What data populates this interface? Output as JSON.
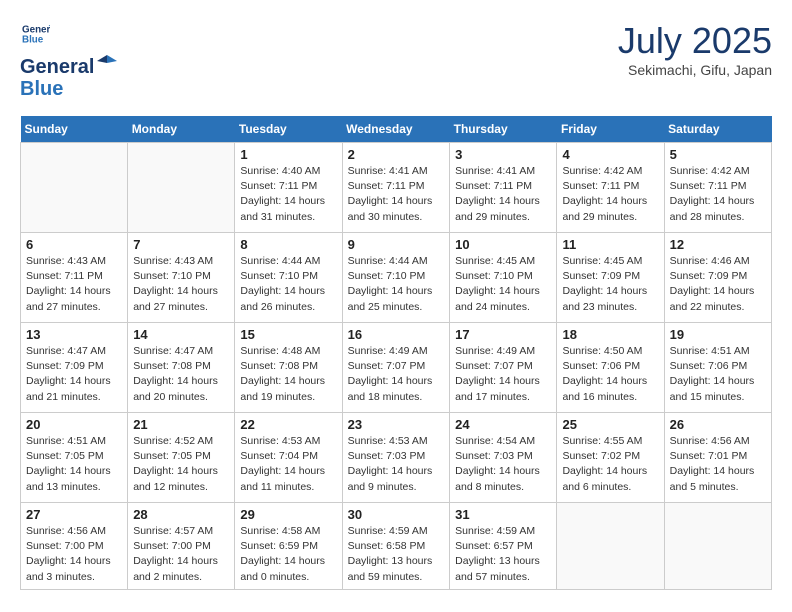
{
  "header": {
    "logo_line1": "General",
    "logo_line2": "Blue",
    "month": "July 2025",
    "location": "Sekimachi, Gifu, Japan"
  },
  "weekdays": [
    "Sunday",
    "Monday",
    "Tuesday",
    "Wednesday",
    "Thursday",
    "Friday",
    "Saturday"
  ],
  "weeks": [
    [
      {
        "day": "",
        "info": ""
      },
      {
        "day": "",
        "info": ""
      },
      {
        "day": "1",
        "info": "Sunrise: 4:40 AM\nSunset: 7:11 PM\nDaylight: 14 hours\nand 31 minutes."
      },
      {
        "day": "2",
        "info": "Sunrise: 4:41 AM\nSunset: 7:11 PM\nDaylight: 14 hours\nand 30 minutes."
      },
      {
        "day": "3",
        "info": "Sunrise: 4:41 AM\nSunset: 7:11 PM\nDaylight: 14 hours\nand 29 minutes."
      },
      {
        "day": "4",
        "info": "Sunrise: 4:42 AM\nSunset: 7:11 PM\nDaylight: 14 hours\nand 29 minutes."
      },
      {
        "day": "5",
        "info": "Sunrise: 4:42 AM\nSunset: 7:11 PM\nDaylight: 14 hours\nand 28 minutes."
      }
    ],
    [
      {
        "day": "6",
        "info": "Sunrise: 4:43 AM\nSunset: 7:11 PM\nDaylight: 14 hours\nand 27 minutes."
      },
      {
        "day": "7",
        "info": "Sunrise: 4:43 AM\nSunset: 7:10 PM\nDaylight: 14 hours\nand 27 minutes."
      },
      {
        "day": "8",
        "info": "Sunrise: 4:44 AM\nSunset: 7:10 PM\nDaylight: 14 hours\nand 26 minutes."
      },
      {
        "day": "9",
        "info": "Sunrise: 4:44 AM\nSunset: 7:10 PM\nDaylight: 14 hours\nand 25 minutes."
      },
      {
        "day": "10",
        "info": "Sunrise: 4:45 AM\nSunset: 7:10 PM\nDaylight: 14 hours\nand 24 minutes."
      },
      {
        "day": "11",
        "info": "Sunrise: 4:45 AM\nSunset: 7:09 PM\nDaylight: 14 hours\nand 23 minutes."
      },
      {
        "day": "12",
        "info": "Sunrise: 4:46 AM\nSunset: 7:09 PM\nDaylight: 14 hours\nand 22 minutes."
      }
    ],
    [
      {
        "day": "13",
        "info": "Sunrise: 4:47 AM\nSunset: 7:09 PM\nDaylight: 14 hours\nand 21 minutes."
      },
      {
        "day": "14",
        "info": "Sunrise: 4:47 AM\nSunset: 7:08 PM\nDaylight: 14 hours\nand 20 minutes."
      },
      {
        "day": "15",
        "info": "Sunrise: 4:48 AM\nSunset: 7:08 PM\nDaylight: 14 hours\nand 19 minutes."
      },
      {
        "day": "16",
        "info": "Sunrise: 4:49 AM\nSunset: 7:07 PM\nDaylight: 14 hours\nand 18 minutes."
      },
      {
        "day": "17",
        "info": "Sunrise: 4:49 AM\nSunset: 7:07 PM\nDaylight: 14 hours\nand 17 minutes."
      },
      {
        "day": "18",
        "info": "Sunrise: 4:50 AM\nSunset: 7:06 PM\nDaylight: 14 hours\nand 16 minutes."
      },
      {
        "day": "19",
        "info": "Sunrise: 4:51 AM\nSunset: 7:06 PM\nDaylight: 14 hours\nand 15 minutes."
      }
    ],
    [
      {
        "day": "20",
        "info": "Sunrise: 4:51 AM\nSunset: 7:05 PM\nDaylight: 14 hours\nand 13 minutes."
      },
      {
        "day": "21",
        "info": "Sunrise: 4:52 AM\nSunset: 7:05 PM\nDaylight: 14 hours\nand 12 minutes."
      },
      {
        "day": "22",
        "info": "Sunrise: 4:53 AM\nSunset: 7:04 PM\nDaylight: 14 hours\nand 11 minutes."
      },
      {
        "day": "23",
        "info": "Sunrise: 4:53 AM\nSunset: 7:03 PM\nDaylight: 14 hours\nand 9 minutes."
      },
      {
        "day": "24",
        "info": "Sunrise: 4:54 AM\nSunset: 7:03 PM\nDaylight: 14 hours\nand 8 minutes."
      },
      {
        "day": "25",
        "info": "Sunrise: 4:55 AM\nSunset: 7:02 PM\nDaylight: 14 hours\nand 6 minutes."
      },
      {
        "day": "26",
        "info": "Sunrise: 4:56 AM\nSunset: 7:01 PM\nDaylight: 14 hours\nand 5 minutes."
      }
    ],
    [
      {
        "day": "27",
        "info": "Sunrise: 4:56 AM\nSunset: 7:00 PM\nDaylight: 14 hours\nand 3 minutes."
      },
      {
        "day": "28",
        "info": "Sunrise: 4:57 AM\nSunset: 7:00 PM\nDaylight: 14 hours\nand 2 minutes."
      },
      {
        "day": "29",
        "info": "Sunrise: 4:58 AM\nSunset: 6:59 PM\nDaylight: 14 hours\nand 0 minutes."
      },
      {
        "day": "30",
        "info": "Sunrise: 4:59 AM\nSunset: 6:58 PM\nDaylight: 13 hours\nand 59 minutes."
      },
      {
        "day": "31",
        "info": "Sunrise: 4:59 AM\nSunset: 6:57 PM\nDaylight: 13 hours\nand 57 minutes."
      },
      {
        "day": "",
        "info": ""
      },
      {
        "day": "",
        "info": ""
      }
    ]
  ]
}
